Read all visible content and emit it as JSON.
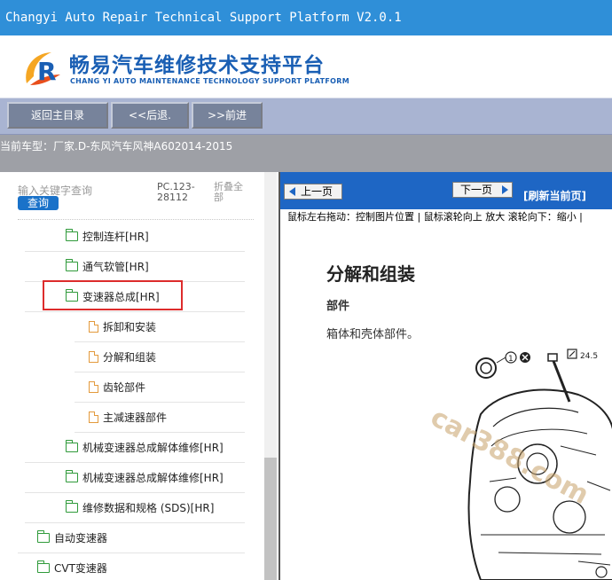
{
  "window": {
    "title": "Changyi Auto Repair Technical Support Platform V2.0.1"
  },
  "header": {
    "logo_cn": "畅易汽车维修技术支持平台",
    "logo_en": "CHANG YI AUTO MAINTENANCE TECHNOLOGY SUPPORT PLATFORM",
    "logo_icon": "stylized-R-logo-icon"
  },
  "toolbar": {
    "home_label": "返回主目录",
    "back_label": "<<后退.",
    "forward_label": ">>前进"
  },
  "vehicle": {
    "label": "当前车型：",
    "value": "厂家.D-东风汽车风神A602014-2015"
  },
  "search": {
    "placeholder": "输入关键字查询",
    "query_label": "查询",
    "pc_code": "PC.123-28112",
    "collapse_label": "折叠全部"
  },
  "tree": {
    "items": [
      {
        "label": "控制连杆[HR]",
        "icon": "folder-icon"
      },
      {
        "label": "通气软管[HR]",
        "icon": "folder-icon"
      },
      {
        "label": "变速器总成[HR]",
        "icon": "folder-open-icon",
        "selected": true
      },
      {
        "label": "拆卸和安装",
        "icon": "document-icon"
      },
      {
        "label": "分解和组装",
        "icon": "document-icon"
      },
      {
        "label": "齿轮部件",
        "icon": "document-icon"
      },
      {
        "label": "主减速器部件",
        "icon": "document-icon"
      },
      {
        "label": "机械变速器总成解体维修[HR]",
        "icon": "folder-icon"
      },
      {
        "label": "机械变速器总成解体维修[HR]",
        "icon": "folder-icon"
      },
      {
        "label": "维修数据和规格 (SDS)[HR]",
        "icon": "folder-icon"
      },
      {
        "label": "自动变速器",
        "icon": "folder-icon"
      },
      {
        "label": "CVT变速器",
        "icon": "folder-icon"
      }
    ]
  },
  "viewer": {
    "prev_label": "上一页",
    "next_label": "下一页",
    "refresh_label": "[刷新当前页]",
    "hint": "鼠标左右拖动：控制图片位置 | 鼠标滚轮向上 放大  滚轮向下：缩小 |"
  },
  "document": {
    "title": "分解和组装",
    "section": "部件",
    "description": "箱体和壳体部件。",
    "torque_label": "24.5",
    "watermark": "car388.com"
  },
  "colors": {
    "title_bar": "#2f8fd8",
    "brand_blue": "#1a5fb4",
    "toolbar": "#a9b4d2",
    "toolbar_button": "#77839b",
    "vehicle_bar": "#9ea0a6",
    "viewer_nav": "#1e66c4",
    "folder_icon": "#2f9a3a",
    "doc_icon": "#e39a3c",
    "highlight": "#dd2c2c"
  }
}
